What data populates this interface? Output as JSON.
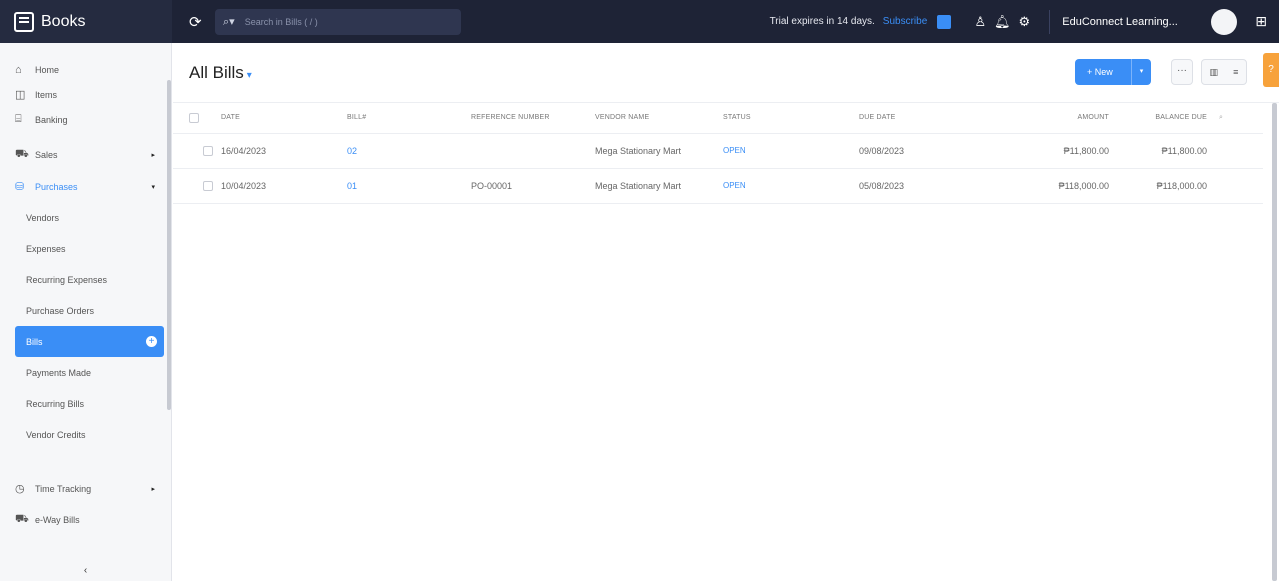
{
  "topbar": {
    "app_name": "Books",
    "search_placeholder": "Search in Bills ( / )",
    "trial_text": "Trial expires in 14 days.",
    "subscribe_label": "Subscribe",
    "org_name": "EduConnect Learning...",
    "icons": [
      "refresh-icon",
      "search-icon",
      "user-icon",
      "bell-icon",
      "gear-icon",
      "apps-grid-icon"
    ]
  },
  "sidebar": {
    "items": [
      {
        "label": "Home",
        "icon": "home-icon"
      },
      {
        "label": "Items",
        "icon": "items-icon"
      },
      {
        "label": "Banking",
        "icon": "bank-icon"
      },
      {
        "label": "Sales",
        "icon": "cart-icon"
      },
      {
        "label": "Purchases",
        "icon": "bag-icon"
      }
    ],
    "purchases_sub": [
      {
        "label": "Vendors"
      },
      {
        "label": "Expenses"
      },
      {
        "label": "Recurring Expenses"
      },
      {
        "label": "Purchase Orders"
      },
      {
        "label": "Bills"
      },
      {
        "label": "Payments Made"
      },
      {
        "label": "Recurring Bills"
      },
      {
        "label": "Vendor Credits"
      }
    ],
    "bottom_items": [
      {
        "label": "Time Tracking",
        "icon": "clock-icon"
      },
      {
        "label": "e-Way Bills",
        "icon": "truck-icon"
      }
    ],
    "collapse_label": "‹"
  },
  "main": {
    "title": "All Bills",
    "new_label": "+ New",
    "columns": [
      "Date",
      "Bill#",
      "Reference Number",
      "Vendor Name",
      "Status",
      "Due Date",
      "Amount",
      "Balance Due"
    ],
    "rows": [
      {
        "date": "16/04/2023",
        "bill": "02",
        "ref": "",
        "vendor": "Mega Stationary Mart",
        "status": "OPEN",
        "due": "09/08/2023",
        "amount": "₱11,800.00",
        "balance": "₱11,800.00"
      },
      {
        "date": "10/04/2023",
        "bill": "01",
        "ref": "PO-00001",
        "vendor": "Mega Stationary Mart",
        "status": "OPEN",
        "due": "05/08/2023",
        "amount": "₱118,000.00",
        "balance": "₱118,000.00"
      }
    ]
  },
  "colors": {
    "accent": "#3a8ef6",
    "topbar": "#1e2336",
    "help": "#f7a23b"
  }
}
